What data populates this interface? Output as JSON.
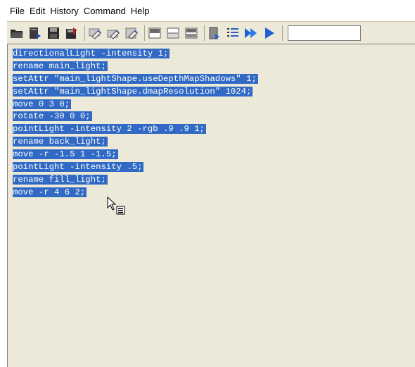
{
  "menu": {
    "items": [
      "File",
      "Edit",
      "History",
      "Command",
      "Help"
    ]
  },
  "toolbar": {
    "buttons": [
      {
        "icon": "open-script-icon"
      },
      {
        "icon": "source-script-icon"
      },
      {
        "icon": "save-script-icon"
      },
      {
        "icon": "save-to-shelf-icon"
      },
      {
        "icon": "clear-history-icon"
      },
      {
        "icon": "clear-input-icon"
      },
      {
        "icon": "clear-all-icon"
      },
      {
        "icon": "show-history-only-icon"
      },
      {
        "icon": "show-input-only-icon"
      },
      {
        "icon": "show-both-icon"
      },
      {
        "icon": "echo-all-commands-icon"
      },
      {
        "icon": "show-line-numbers-icon"
      },
      {
        "icon": "execute-all-icon"
      },
      {
        "icon": "execute-selected-icon"
      }
    ],
    "command_field_value": ""
  },
  "editor": {
    "lines": [
      "directionalLight -intensity 1;",
      "rename main_light;",
      "setAttr \"main_lightShape.useDepthMapShadows\" 1;",
      "setAttr \"main_lightShape.dmapResolution\" 1024;",
      "move 0 3 0;",
      "rotate -30 0 0;",
      "pointLight -intensity 2 -rgb .9 .9 1;",
      "rename back_light;",
      "move -r -1.5 1 -1.5;",
      "pointLight -intensity .5;",
      "rename fill_light;",
      "move -r 4 6 2;"
    ],
    "selection_color": "#316ac5",
    "background_color": "#ece9d8"
  },
  "cursor": {
    "icon": "arrow-copy-cursor-icon"
  }
}
